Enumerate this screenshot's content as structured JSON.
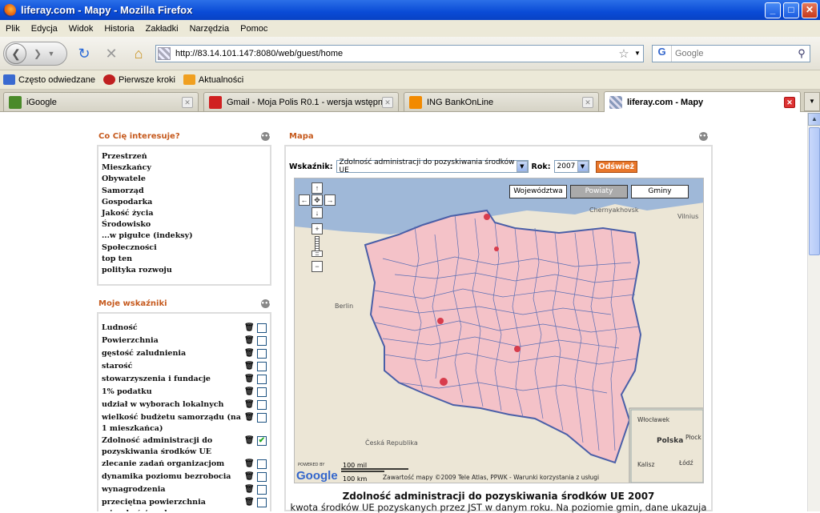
{
  "window": {
    "title": "liferay.com - Mapy - Mozilla Firefox",
    "min": "_",
    "max": "□",
    "close": "✕"
  },
  "menu": [
    "Plik",
    "Edycja",
    "Widok",
    "Historia",
    "Zakładki",
    "Narzędzia",
    "Pomoc"
  ],
  "nav": {
    "url": "http://83.14.101.147:8080/web/guest/home",
    "search_placeholder": "Google",
    "search_engine": "G"
  },
  "bookmarks": [
    {
      "label": "Często odwiedzane",
      "color": "#3a6ad0"
    },
    {
      "label": "Pierwsze kroki",
      "color": "#c02020"
    },
    {
      "label": "Aktualności",
      "color": "#f0a020"
    }
  ],
  "tabs": [
    {
      "title": "iGoogle",
      "active": false,
      "icon_color": "#4a8a2a"
    },
    {
      "title": "Gmail - Moja Polis R0.1 - wersja wstępn...",
      "active": false,
      "icon_color": "#d02020"
    },
    {
      "title": "ING BankOnLine",
      "active": false,
      "icon_color": "#f28a00"
    },
    {
      "title": "liferay.com - Mapy",
      "active": true,
      "icon_color": "#8899bb"
    }
  ],
  "interests": {
    "title": "Co Cię interesuje?",
    "items": [
      "Przestrzeń",
      "Mieszkańcy",
      "Obywatele",
      "Samorząd",
      "Gospodarka",
      "Jakość życia",
      "Środowisko",
      "...w pigułce (indeksy)",
      "Społeczności",
      "top ten",
      "polityka rozwoju"
    ]
  },
  "indicators": {
    "title": "Moje wskaźniki",
    "items": [
      {
        "label": "Ludność",
        "checked": false
      },
      {
        "label": "Powierzchnia",
        "checked": false
      },
      {
        "label": "gęstość zaludnienia",
        "checked": false
      },
      {
        "label": "starość",
        "checked": false
      },
      {
        "label": "stowarzyszenia i fundacje",
        "checked": false
      },
      {
        "label": "1% podatku",
        "checked": false
      },
      {
        "label": "udział w wyborach lokalnych",
        "checked": false
      },
      {
        "label": "wielkość budżetu samorządu (na 1 mieszkańca)",
        "checked": false
      },
      {
        "label": "Zdolność administracji do pozyskiwania środków UE",
        "checked": true
      },
      {
        "label": "zlecanie zadań organizacjom",
        "checked": false
      },
      {
        "label": "dynamika poziomu bezrobocia",
        "checked": false
      },
      {
        "label": "wynagrodzenia",
        "checked": false
      },
      {
        "label": "przeciętna powierzchnia mieszkań / osoba",
        "checked": false
      }
    ]
  },
  "map_portlet": {
    "title": "Mapa",
    "indicator_label": "Wskaźnik:",
    "indicator_value": "Zdolność administracji do pozyskiwania środków UE",
    "year_label": "Rok:",
    "year_value": "2007",
    "refresh": "Odśwież",
    "types": [
      "Województwa",
      "Powiaty",
      "Gminy"
    ],
    "active_type": "Powiaty",
    "scale_mi": "100 mil",
    "scale_km": "100 km",
    "attribution": "Zawartość mapy ©2009 Tele Atlas, PPWK - Warunki korzystania z usługi",
    "powered": "POWERED BY",
    "google": "Google",
    "place_labels": [
      "Berlin",
      "Česká Republika",
      "Chernyakhovsk",
      "Vilnius",
      "Włocławek",
      "Polska",
      "Płock",
      "Łódź",
      "Kalisz"
    ],
    "caption_title": "Zdolność administracji do pozyskiwania środków UE 2007",
    "caption_text": "kwota środków UE pozyskanych przez JST w danym roku. Na poziomie gmin, dane ukazuja"
  },
  "colors": {
    "accent": "#c65a1e",
    "region_fill": "#f4c2c8",
    "region_border": "#4a5fa8",
    "highlight": "#d83c4c",
    "refresh": "#e8762a"
  }
}
